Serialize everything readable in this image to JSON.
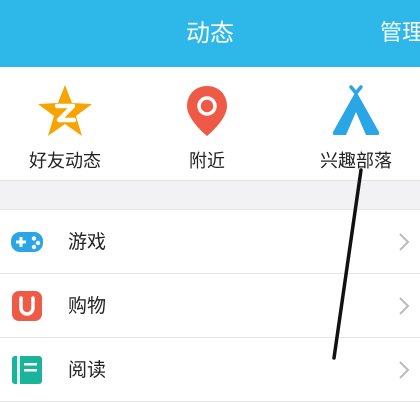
{
  "header": {
    "title": "动态",
    "manage_label": "管理"
  },
  "quick_items": [
    {
      "label": "好友动态",
      "icon": "qzone-star-icon",
      "color": "#f7a300"
    },
    {
      "label": "附近",
      "icon": "location-pin-icon",
      "color": "#ef5a47"
    },
    {
      "label": "兴趣部落",
      "icon": "tent-icon",
      "color": "#2aa5e6"
    }
  ],
  "list_items": [
    {
      "label": "游戏",
      "icon": "gamepad-icon",
      "color": "#2aa5e6"
    },
    {
      "label": "购物",
      "icon": "shopping-icon",
      "color": "#ef5a47"
    },
    {
      "label": "阅读",
      "icon": "book-icon",
      "color": "#19b49a"
    }
  ],
  "colors": {
    "header": "#2eb8ea",
    "separator": "#f2f2f4"
  }
}
